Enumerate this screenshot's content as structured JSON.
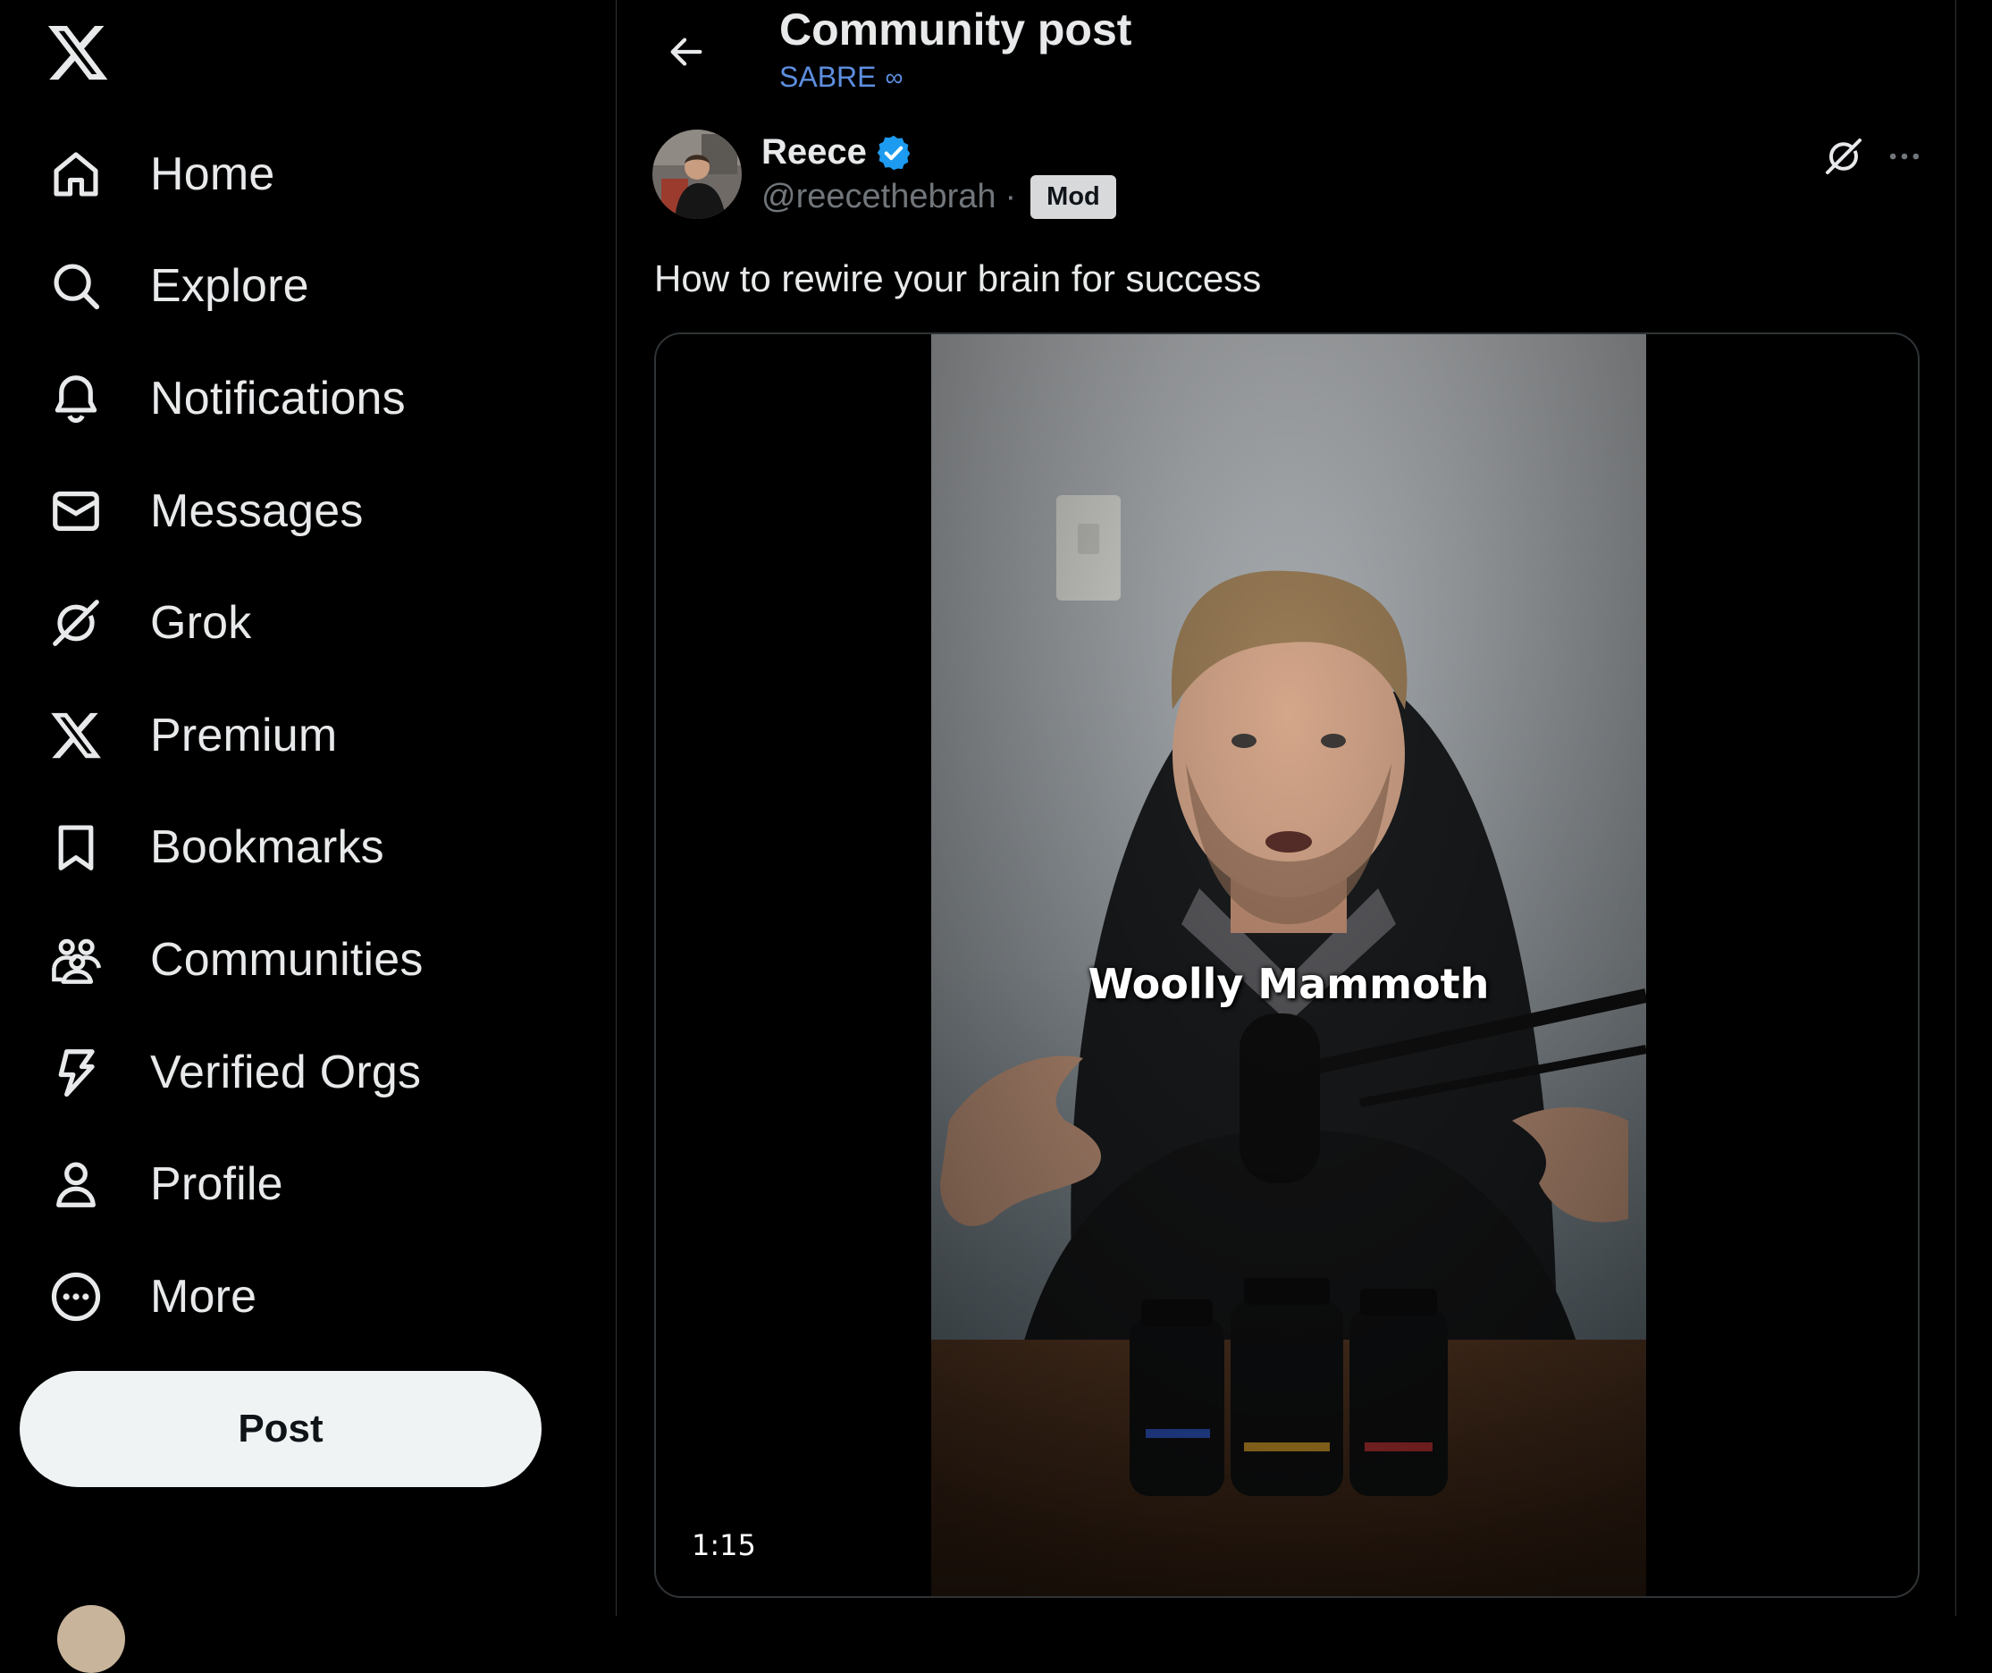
{
  "sidebar": {
    "logo": "x-logo-icon",
    "items": [
      {
        "label": "Home",
        "icon": "home-icon"
      },
      {
        "label": "Explore",
        "icon": "search-icon"
      },
      {
        "label": "Notifications",
        "icon": "bell-icon"
      },
      {
        "label": "Messages",
        "icon": "envelope-icon"
      },
      {
        "label": "Grok",
        "icon": "grok-icon"
      },
      {
        "label": "Premium",
        "icon": "x-logo-icon"
      },
      {
        "label": "Bookmarks",
        "icon": "bookmark-icon"
      },
      {
        "label": "Communities",
        "icon": "communities-icon"
      },
      {
        "label": "Verified Orgs",
        "icon": "lightning-icon"
      },
      {
        "label": "Profile",
        "icon": "person-icon"
      },
      {
        "label": "More",
        "icon": "more-circle-icon"
      }
    ],
    "post_button_label": "Post"
  },
  "header": {
    "title": "Community post",
    "community_name": "SABRE",
    "community_symbol": "∞"
  },
  "post": {
    "author_name": "Reece",
    "author_handle": "@reecethebrah",
    "separator": "·",
    "role_badge": "Mod",
    "text": "How to rewire your brain for success",
    "video": {
      "caption": "Woolly Mammoth",
      "duration": "1:15"
    }
  },
  "colors": {
    "background": "#000000",
    "text_primary": "#e7e9ea",
    "text_secondary": "#71767b",
    "accent_blue": "#1d9bf0",
    "community_link": "#5d8ee0",
    "border": "#2f3336"
  }
}
